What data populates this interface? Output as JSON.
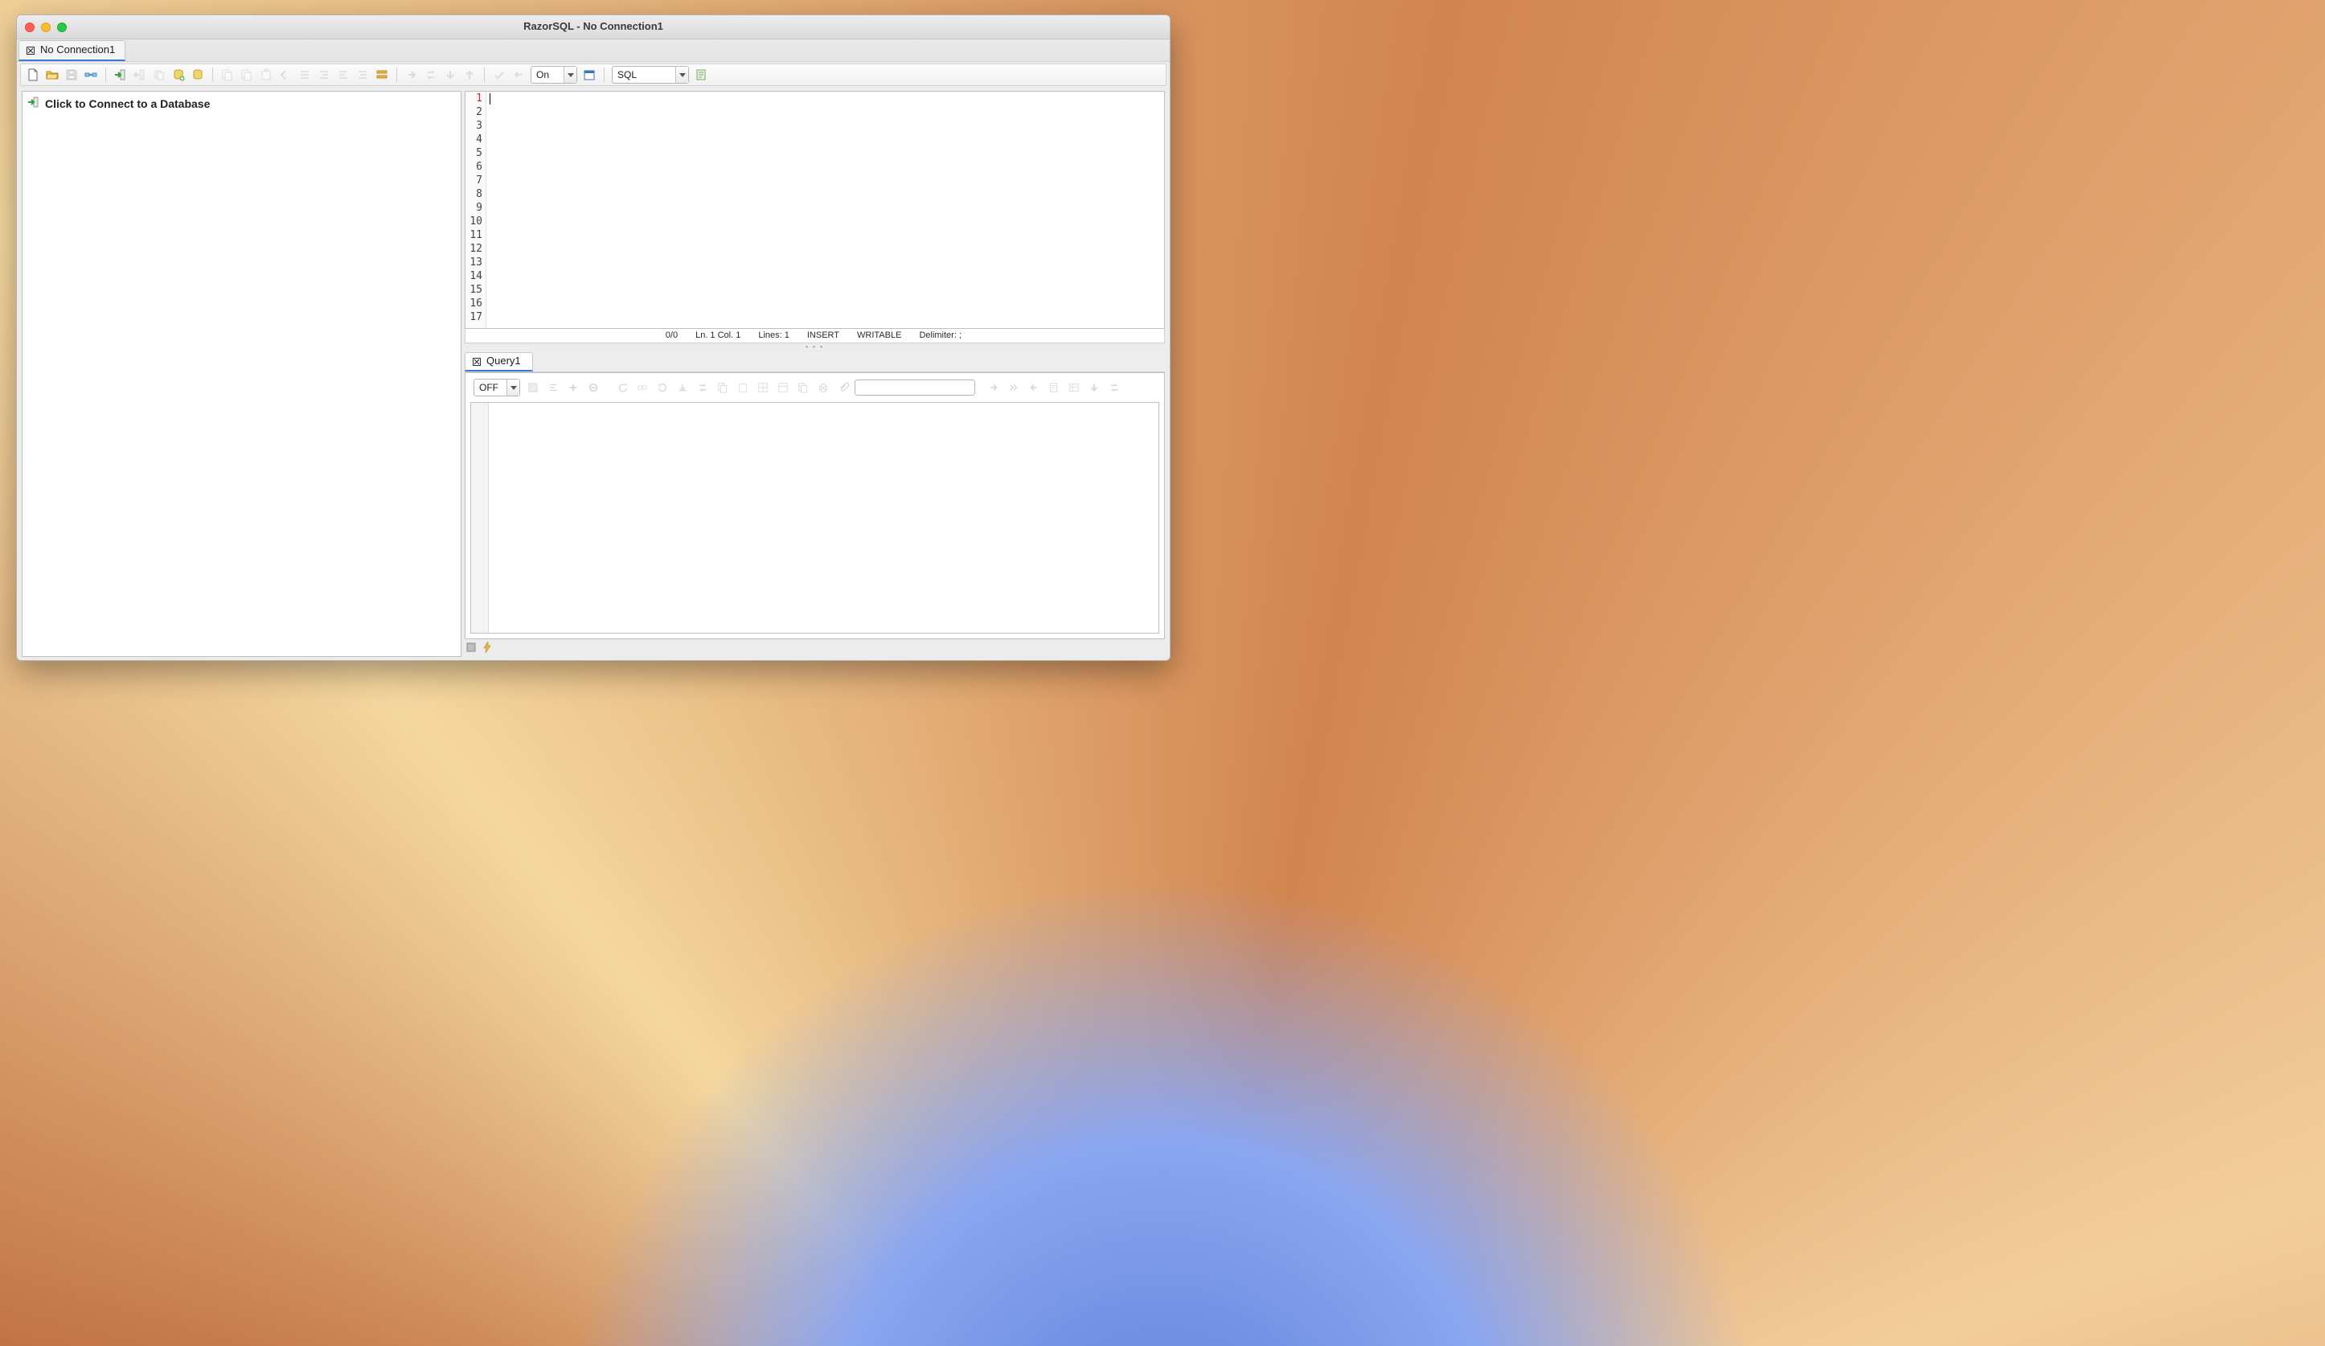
{
  "window": {
    "title": "RazorSQL - No Connection1"
  },
  "connectTab": {
    "label": "No Connection1"
  },
  "toolbar": {
    "autocomplete": {
      "value": "On"
    },
    "language": {
      "value": "SQL"
    }
  },
  "sidebar": {
    "connectPrompt": "Click to Connect to a Database"
  },
  "editor": {
    "lineNumbers": [
      "1",
      "2",
      "3",
      "4",
      "5",
      "6",
      "7",
      "8",
      "9",
      "10",
      "11",
      "12",
      "13",
      "14",
      "15",
      "16",
      "17"
    ]
  },
  "editorStatus": {
    "counter": "0/0",
    "cursor": "Ln. 1 Col. 1",
    "lines": "Lines: 1",
    "mode": "INSERT",
    "rw": "WRITABLE",
    "delimiter": "Delimiter: ;"
  },
  "results": {
    "tabLabel": "Query1",
    "filter": {
      "value": "OFF"
    },
    "search": {
      "placeholder": ""
    }
  }
}
